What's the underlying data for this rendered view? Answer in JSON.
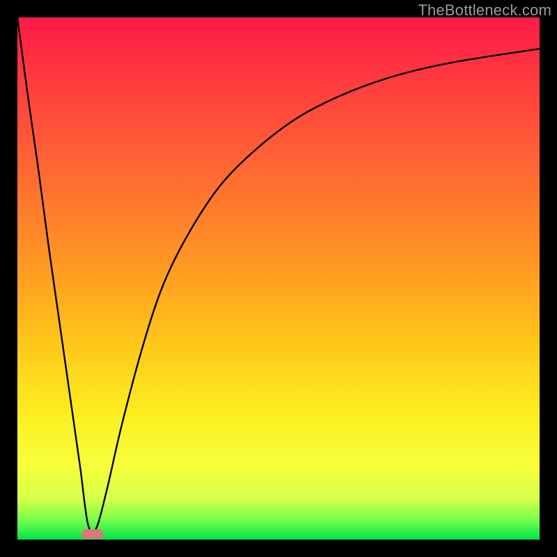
{
  "watermark": "TheBottleneck.com",
  "chart_data": {
    "type": "line",
    "title": "",
    "xlabel": "",
    "ylabel": "",
    "xlim": [
      0,
      100
    ],
    "ylim": [
      0,
      100
    ],
    "series": [
      {
        "name": "bottleneck-curve",
        "x": [
          0,
          2,
          4,
          6,
          8,
          10,
          12,
          13.5,
          15,
          17,
          20,
          24,
          28,
          33,
          39,
          46,
          54,
          63,
          73,
          84,
          100
        ],
        "y": [
          100,
          85,
          71,
          56,
          42,
          28,
          14,
          3,
          2,
          9,
          22,
          37,
          49,
          59,
          68,
          75,
          81,
          85.5,
          89,
          91.5,
          94
        ]
      }
    ],
    "marker": {
      "name": "optimal-zone",
      "x_start": 12.2,
      "x_end": 16.5,
      "y": 1.1
    },
    "background": {
      "gradient": "vertical",
      "stops": [
        {
          "pos": 0,
          "color": "#ff1a49"
        },
        {
          "pos": 24,
          "color": "#ff5a36"
        },
        {
          "pos": 48,
          "color": "#ff9a22"
        },
        {
          "pos": 76,
          "color": "#fcee20"
        },
        {
          "pos": 96,
          "color": "#7dff4a"
        },
        {
          "pos": 100,
          "color": "#00e54a"
        }
      ]
    }
  }
}
